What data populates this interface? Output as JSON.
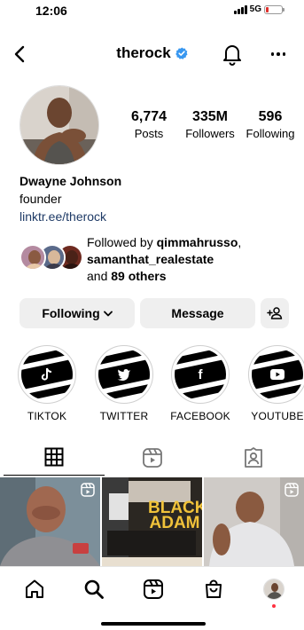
{
  "status_bar": {
    "time": "12:06",
    "network": "5G",
    "battery_level": 0.2
  },
  "header": {
    "username": "therock",
    "verified": true
  },
  "profile": {
    "stats": [
      {
        "value": "6,774",
        "label": "Posts"
      },
      {
        "value": "335M",
        "label": "Followers"
      },
      {
        "value": "596",
        "label": "Following"
      }
    ],
    "name": "Dwayne Johnson",
    "category": "founder",
    "link": "linktr.ee/therock"
  },
  "followed_by": {
    "prefix": "Followed by",
    "user1": "qimmahrusso",
    "user2": "samanthat_realestate",
    "and": "and",
    "others": "89 others"
  },
  "actions": {
    "following_label": "Following",
    "message_label": "Message"
  },
  "highlights": [
    {
      "label": "TIKTOK",
      "icon": "tiktok-icon"
    },
    {
      "label": "TWITTER",
      "icon": "twitter-icon"
    },
    {
      "label": "FACEBOOK",
      "icon": "facebook-icon"
    },
    {
      "label": "YOUTUBE",
      "icon": "youtube-icon"
    }
  ],
  "tabs": [
    {
      "icon": "grid-icon",
      "active": true
    },
    {
      "icon": "reels-icon",
      "active": false
    },
    {
      "icon": "tagged-icon",
      "active": false
    }
  ],
  "grid_posts": [
    {
      "kind": "reel"
    },
    {
      "kind": "image",
      "overlay_text": "BLACK ADAM"
    },
    {
      "kind": "reel"
    }
  ],
  "bottom_nav": [
    "home-icon",
    "search-icon",
    "reels-icon",
    "shop-icon",
    "profile-avatar"
  ],
  "colors": {
    "verified": "#3897f0",
    "link": "#1e3a66",
    "button_bg": "#efefef",
    "notification_dot": "#ff3040"
  }
}
